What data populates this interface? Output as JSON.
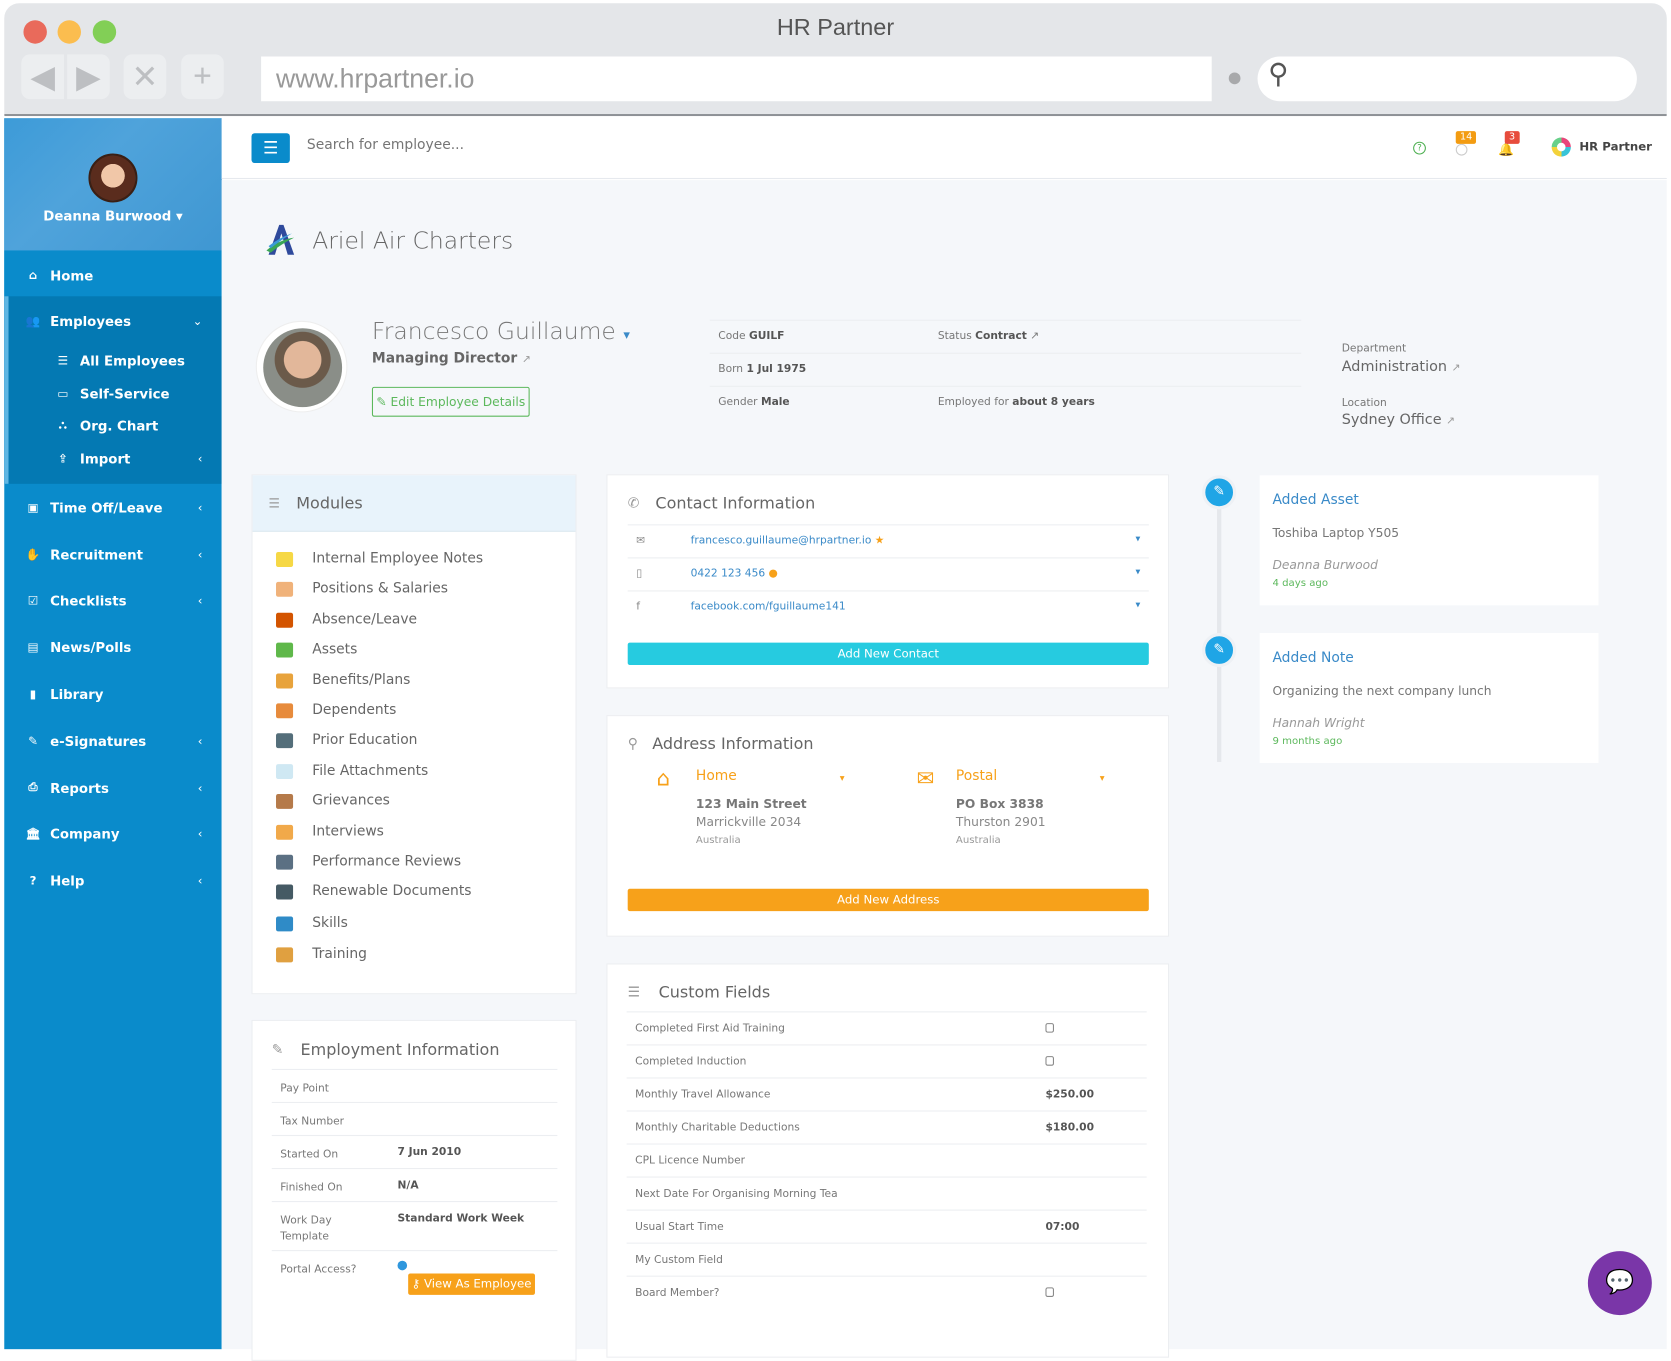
{
  "browser": {
    "title": "HR Partner",
    "url": "www.hrpartner.io",
    "colors": {
      "close": "#e96a5b",
      "min": "#fbbd4f",
      "max": "#82cf56"
    }
  },
  "sidebar": {
    "user_name": "Deanna Burwood",
    "items": [
      {
        "label": "Home",
        "icon": "home-icon",
        "glyph": "⌂"
      },
      {
        "label": "Employees",
        "icon": "users-icon",
        "glyph": "👥",
        "chevron": "⌄"
      },
      {
        "label": "All Employees",
        "icon": "list-icon",
        "glyph": "☰"
      },
      {
        "label": "Self-Service",
        "icon": "laptop-icon",
        "glyph": "▭"
      },
      {
        "label": "Org. Chart",
        "icon": "sitemap-icon",
        "glyph": "⛬"
      },
      {
        "label": "Import",
        "icon": "upload-icon",
        "glyph": "⇪",
        "chevron": "‹"
      },
      {
        "label": "Time Off/Leave",
        "icon": "suitcase-icon",
        "glyph": "▣",
        "chevron": "‹"
      },
      {
        "label": "Recruitment",
        "icon": "handshake-icon",
        "glyph": "✋",
        "chevron": "‹"
      },
      {
        "label": "Checklists",
        "icon": "check-square-icon",
        "glyph": "☑",
        "chevron": "‹"
      },
      {
        "label": "News/Polls",
        "icon": "newspaper-icon",
        "glyph": "▤"
      },
      {
        "label": "Library",
        "icon": "file-icon",
        "glyph": "▮"
      },
      {
        "label": "e-Signatures",
        "icon": "pencil-icon",
        "glyph": "✎",
        "chevron": "‹"
      },
      {
        "label": "Reports",
        "icon": "print-icon",
        "glyph": "⎙",
        "chevron": "‹"
      },
      {
        "label": "Company",
        "icon": "bank-icon",
        "glyph": "🏛",
        "chevron": "‹"
      },
      {
        "label": "Help",
        "icon": "question-icon",
        "glyph": "?",
        "chevron": "‹"
      }
    ]
  },
  "topbar": {
    "search_placeholder": "Search for employee...",
    "badge_clock": "14",
    "badge_bell": "3",
    "brand": "HR Partner"
  },
  "company": {
    "name": "Ariel Air Charters"
  },
  "employee": {
    "name": "Francesco Guillaume",
    "title": "Managing Director",
    "edit_label": "Edit Employee Details",
    "code_label": "Code",
    "code": "GUILF",
    "status_label": "Status",
    "status": "Contract",
    "born_label": "Born",
    "born": "1 Jul 1975",
    "gender_label": "Gender",
    "gender": "Male",
    "employed_label": "Employed for",
    "employed": "about 8 years",
    "department_label": "Department",
    "department": "Administration",
    "location_label": "Location",
    "location": "Sydney Office"
  },
  "modules": {
    "title": "Modules",
    "items": [
      {
        "label": "Internal Employee Notes",
        "color": "#f6d845"
      },
      {
        "label": "Positions & Salaries",
        "color": "#f0b27a"
      },
      {
        "label": "Absence/Leave",
        "color": "#d35400"
      },
      {
        "label": "Assets",
        "color": "#5fb84a"
      },
      {
        "label": "Benefits/Plans",
        "color": "#e8a33c"
      },
      {
        "label": "Dependents",
        "color": "#e78b3c"
      },
      {
        "label": "Prior Education",
        "color": "#546e7a"
      },
      {
        "label": "File Attachments",
        "color": "#cfe8f3"
      },
      {
        "label": "Grievances",
        "color": "#b57a4a"
      },
      {
        "label": "Interviews",
        "color": "#f1a94a"
      },
      {
        "label": "Performance Reviews",
        "color": "#5b7083"
      },
      {
        "label": "Renewable Documents",
        "color": "#455a64"
      },
      {
        "label": "Skills",
        "color": "#2f8bc7"
      },
      {
        "label": "Training",
        "color": "#e0a040"
      }
    ]
  },
  "contact": {
    "title": "Contact Information",
    "items": [
      {
        "icon": "envelope-icon",
        "glyph": "✉",
        "value": "francesco.guillaume@hrpartner.io",
        "suffix": "★"
      },
      {
        "icon": "mobile-icon",
        "glyph": "▯",
        "value": "0422 123 456",
        "suffix": "●"
      },
      {
        "icon": "facebook-icon",
        "glyph": "f",
        "value": "facebook.com/fguillaume141",
        "suffix": ""
      }
    ],
    "add_label": "Add New Contact",
    "add_color": "#26cbe0"
  },
  "address": {
    "title": "Address Information",
    "items": [
      {
        "type": "Home",
        "line1": "123 Main Street",
        "line2": "Marrickville 2034",
        "country": "Australia"
      },
      {
        "type": "Postal",
        "line1": "PO Box 3838",
        "line2": "Thurston 2901",
        "country": "Australia"
      }
    ],
    "add_label": "Add New Address",
    "accent": "#f7a11a"
  },
  "custom_fields": {
    "title": "Custom Fields",
    "rows": [
      {
        "label": "Completed First Aid Training",
        "value": "",
        "checkbox": true
      },
      {
        "label": "Completed Induction",
        "value": "",
        "checkbox": true
      },
      {
        "label": "Monthly Travel Allowance",
        "value": "$250.00"
      },
      {
        "label": "Monthly Charitable Deductions",
        "value": "$180.00"
      },
      {
        "label": "CPL Licence Number",
        "value": ""
      },
      {
        "label": "Next Date For Organising Morning Tea",
        "value": ""
      },
      {
        "label": "Usual Start Time",
        "value": "07:00"
      },
      {
        "label": "My Custom Field",
        "value": ""
      },
      {
        "label": "Board Member?",
        "value": "",
        "checkbox": true
      }
    ]
  },
  "employment": {
    "title": "Employment Information",
    "rows": [
      {
        "label": "Pay Point",
        "value": ""
      },
      {
        "label": "Tax Number",
        "value": ""
      },
      {
        "label": "Started On",
        "value": "7 Jun 2010"
      },
      {
        "label": "Finished On",
        "value": "N/A"
      },
      {
        "label": "Work Day Template",
        "value": "Standard Work Week"
      },
      {
        "label": "Portal Access?",
        "value": ""
      }
    ],
    "view_as_label": "View As Employee"
  },
  "timeline": [
    {
      "title": "Added Asset",
      "body": "Toshiba Laptop Y505",
      "by": "Deanna Burwood",
      "when": "4 days ago"
    },
    {
      "title": "Added Note",
      "body": "Organizing the next company lunch",
      "by": "Hannah Wright",
      "when": "9 months ago"
    }
  ]
}
